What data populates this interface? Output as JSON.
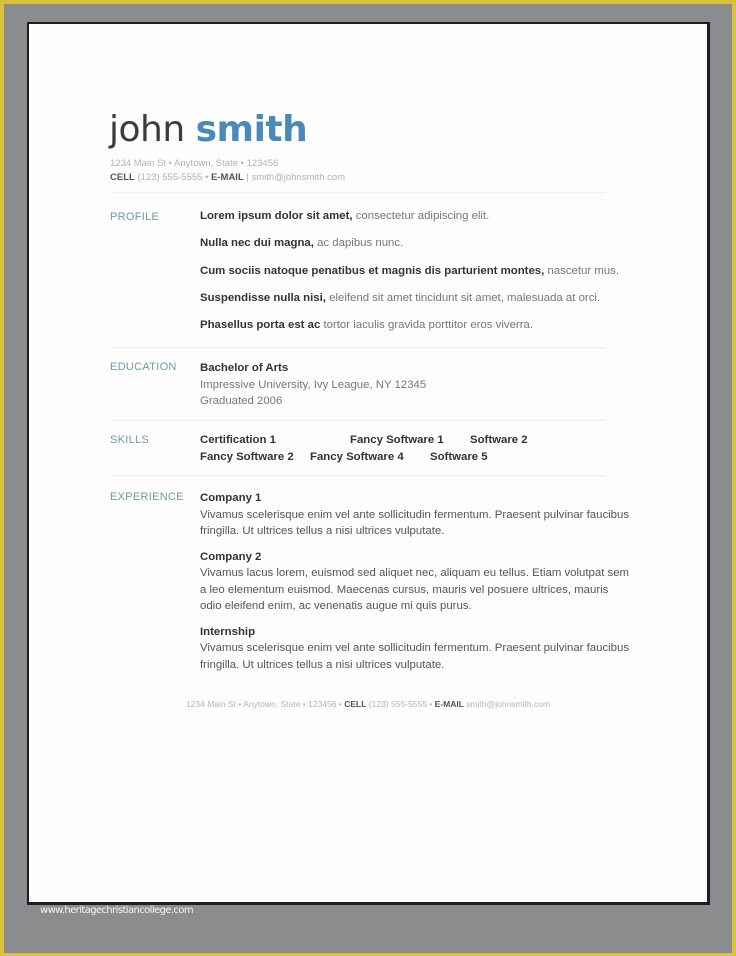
{
  "header": {
    "first_name": "john",
    "last_name": "smith",
    "address_line": "1234 Main St • Anytown, State • 123456",
    "cell_label": "CELL",
    "cell_value": "(123) 555-5555",
    "separator": "•",
    "email_label": "E-MAIL",
    "email_value": "smith@johnsmith.com"
  },
  "sections": {
    "profile": {
      "label": "PROFILE",
      "lines": [
        {
          "bold": "Lorem ipsum dolor sit amet,",
          "rest": " consectetur adipiscing elit."
        },
        {
          "bold": "Nulla nec dui magna,",
          "rest": " ac dapibus nunc."
        },
        {
          "bold": "Cum sociis natoque penatibus et magnis dis parturient montes,",
          "rest": " nascetur mus."
        },
        {
          "bold": "Suspendisse nulla nisi,",
          "rest": " eleifend sit amet tincidunt sit amet, malesuada at orci."
        },
        {
          "bold": "Phasellus porta est ac",
          "rest": " tortor iaculis gravida porttitor eros viverra."
        }
      ]
    },
    "education": {
      "label": "EDUCATION",
      "degree": "Bachelor of Arts",
      "school": "Impressive University, Ivy League, NY 12345",
      "graduated": "Graduated 2006"
    },
    "skills": {
      "label": "SKILLS",
      "row1": [
        "Certification 1",
        "Fancy Software 1",
        "Software 2"
      ],
      "row2": [
        "Fancy Software 2",
        "Fancy Software 4",
        "Software 5"
      ]
    },
    "experience": {
      "label": "EXPERIENCE",
      "items": [
        {
          "title": "Company 1",
          "desc": "Vivamus scelerisque enim vel ante sollicitudin fermentum. Praesent pulvinar faucibus fringilla. Ut ultrices tellus a nisi ultrices vulputate."
        },
        {
          "title": "Company 2",
          "desc": "Vivamus lacus lorem, euismod sed aliquet nec, aliquam eu tellus. Etiam volutpat sem a leo elementum euismod. Maecenas cursus, mauris vel posuere ultrices, mauris odio eleifend enim, ac venenatis augue mi quis purus."
        },
        {
          "title": "Internship",
          "desc": "Vivamus scelerisque enim vel ante sollicitudin fermentum. Praesent pulvinar faucibus fringilla. Ut ultrices tellus a nisi ultrices vulputate."
        }
      ]
    }
  },
  "footer": {
    "address": "1234 Main St • Anytown, State • 123456 •",
    "cell_label": "CELL",
    "cell_value": "(123) 555-5555 •",
    "email_label": "E-MAIL",
    "email_value": "smith@johnsmith.com"
  },
  "watermark": "www.heritagechristiancollege.com"
}
